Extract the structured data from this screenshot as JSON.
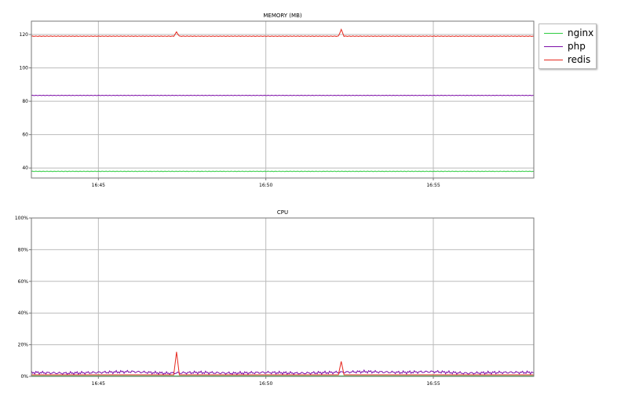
{
  "colors": {
    "nginx": "#2ecc40",
    "php": "#7d0fa8",
    "redis": "#e6271d",
    "grid": "#bbbbbb",
    "axis": "#777777"
  },
  "legend": {
    "items": [
      {
        "name": "nginx",
        "color": "#2ecc40"
      },
      {
        "name": "php",
        "color": "#7d0fa8"
      },
      {
        "name": "redis",
        "color": "#e6271d"
      }
    ]
  },
  "chart_data": [
    {
      "type": "line",
      "title": "MEMORY (MB)",
      "xlabel": "",
      "ylabel": "",
      "xlim": [
        "16:43",
        "16:58"
      ],
      "ylim": [
        34,
        128
      ],
      "yticks": [
        40,
        60,
        80,
        100,
        120
      ],
      "ytick_labels": [
        "40",
        "60",
        "80",
        "100",
        "120"
      ],
      "xticks": [
        "16:45",
        "16:50",
        "16:55"
      ],
      "grid": true,
      "series": [
        {
          "name": "nginx",
          "x": [
            "16:43",
            "16:58"
          ],
          "y": [
            38,
            38
          ]
        },
        {
          "name": "php",
          "x": [
            "16:43",
            "16:58"
          ],
          "y": [
            83.5,
            83.5
          ]
        },
        {
          "name": "redis",
          "x": [
            "16:43",
            "16:47:15",
            "16:47:20",
            "16:47:25",
            "16:52:10",
            "16:52:15",
            "16:52:20",
            "16:58"
          ],
          "y": [
            119,
            119,
            121.5,
            119,
            119,
            123,
            119,
            119
          ]
        }
      ]
    },
    {
      "type": "line",
      "title": "CPU",
      "xlabel": "",
      "ylabel": "",
      "xlim": [
        "16:43",
        "16:58"
      ],
      "ylim": [
        0,
        100
      ],
      "yticks": [
        0,
        20,
        40,
        60,
        80,
        100
      ],
      "ytick_labels": [
        "0%",
        "20%",
        "40%",
        "60%",
        "80%",
        "100%"
      ],
      "xticks": [
        "16:45",
        "16:50",
        "16:55"
      ],
      "grid": true,
      "series": [
        {
          "name": "nginx",
          "x": [
            "16:43",
            "16:58"
          ],
          "y": [
            0.3,
            0.3
          ]
        },
        {
          "name": "php",
          "x": [
            "16:43",
            "16:44",
            "16:45",
            "16:46",
            "16:47",
            "16:48",
            "16:49",
            "16:50",
            "16:51",
            "16:52",
            "16:53",
            "16:54",
            "16:55",
            "16:56",
            "16:57",
            "16:58"
          ],
          "y": [
            2.5,
            2,
            2.5,
            3,
            2,
            2.5,
            2,
            2.5,
            2,
            2.5,
            3,
            2.5,
            3,
            2,
            2.5,
            2.5
          ]
        },
        {
          "name": "redis",
          "x": [
            "16:43",
            "16:47:15",
            "16:47:20",
            "16:47:25",
            "16:52:10",
            "16:52:15",
            "16:52:20",
            "16:58"
          ],
          "y": [
            1,
            1,
            15.5,
            1,
            1,
            9.5,
            1,
            1
          ]
        }
      ]
    }
  ]
}
